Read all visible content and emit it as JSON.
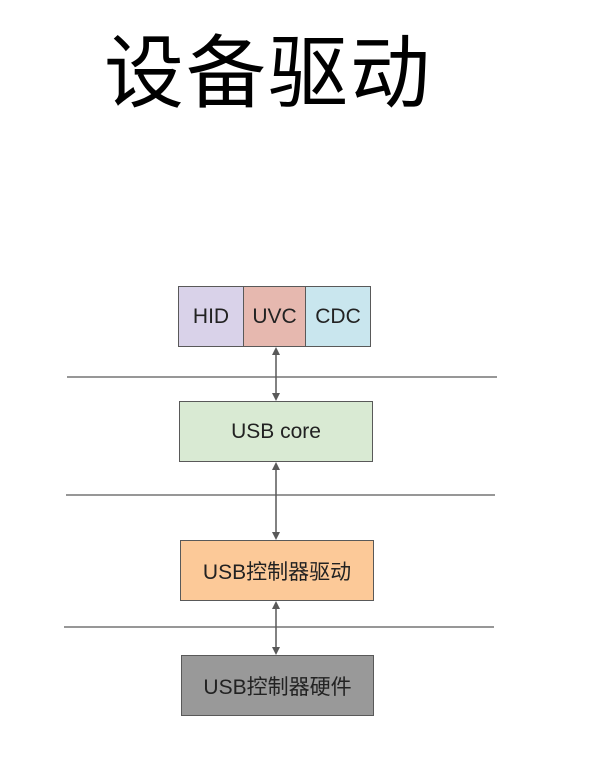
{
  "title": "设备驱动",
  "layers": {
    "class_drivers": [
      {
        "label": "HID",
        "color": "#d9d2e9"
      },
      {
        "label": "UVC",
        "color": "#e6b8af"
      },
      {
        "label": "CDC",
        "color": "#c9e6ee"
      }
    ],
    "core": {
      "label": "USB core",
      "color": "#d9ead3"
    },
    "controller_driver": {
      "label": "USB控制器驱动",
      "color": "#fcc998"
    },
    "controller_hardware": {
      "label": "USB控制器硬件",
      "color": "#999999"
    }
  },
  "colors": {
    "line": "#595959",
    "arrow": "#595959"
  }
}
